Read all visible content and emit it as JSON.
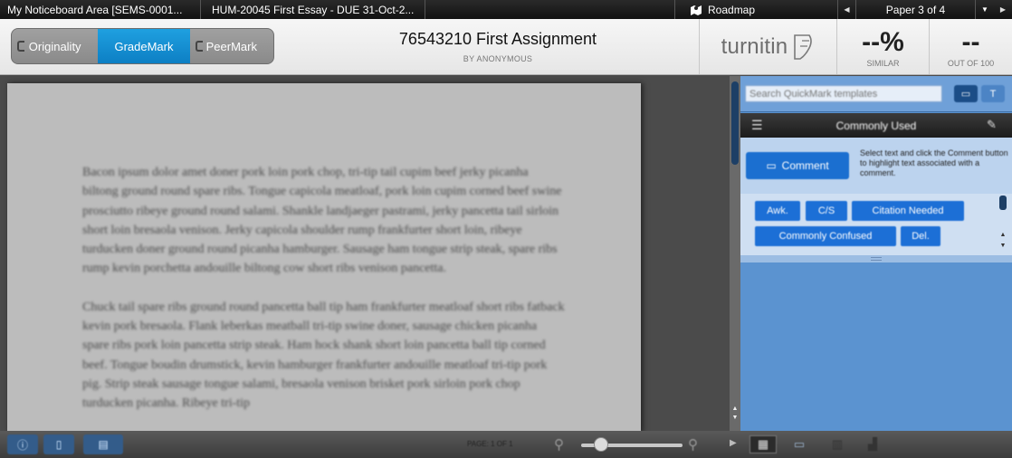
{
  "topbar": {
    "class_name": "My Noticeboard Area [SEMS-0001...",
    "assignment": "HUM-20045 First Essay - DUE 31-Oct-2...",
    "roadmap": "Roadmap",
    "prev_icon": "triangle-left-icon",
    "paper_counter": "Paper 3 of 4",
    "dropdown_icon": "triangle-down-icon",
    "next_icon": "triangle-right-icon"
  },
  "header": {
    "modes": [
      "Originality",
      "GradeMark",
      "PeerMark"
    ],
    "active_mode": "GradeMark",
    "document_title": "76543210 First Assignment",
    "author": "BY ANONYMOUS",
    "logo_text": "turnitin",
    "similarity_value": "--%",
    "similarity_label": "SIMILAR",
    "grade_value": "--",
    "grade_label": "OUT OF 100"
  },
  "document": {
    "paragraphs": [
      "Bacon ipsum dolor amet doner pork loin pork chop, tri-tip tail cupim beef jerky picanha biltong ground round spare ribs. Tongue capicola meatloaf, pork loin cupim corned beef swine prosciutto ribeye ground round salami. Shankle landjaeger pastrami, jerky pancetta tail sirloin short loin bresaola venison. Jerky capicola shoulder rump frankfurter short loin, ribeye turducken doner ground round picanha hamburger. Sausage ham tongue strip steak, spare ribs rump kevin porchetta andouille biltong cow short ribs venison pancetta.",
      "Chuck tail spare ribs ground round pancetta ball tip ham frankfurter meatloaf short ribs fatback kevin pork bresaola. Flank leberkas meatball tri-tip swine doner, sausage chicken picanha spare ribs pork loin pancetta strip steak. Ham hock shank short loin pancetta ball tip corned beef. Tongue boudin drumstick, kevin hamburger frankfurter andouille meatloaf tri-tip pork pig. Strip steak sausage tongue salami, bresaola venison brisket pork sirloin pork chop turducken picanha. Ribeye tri-tip"
    ]
  },
  "footer": {
    "page_indicator": "PAGE: 1 OF 1",
    "zoom_out_icon": "zoom-out-icon",
    "zoom_in_icon": "zoom-in-icon",
    "zoom_level_fraction": 0.2
  },
  "quickmark": {
    "search_placeholder": "Search QuickMark templates",
    "set_title": "Commonly Used",
    "comment_button": "Comment",
    "comment_help": "Select text and click the Comment button to highlight text associated with a comment.",
    "marks": [
      "Awk.",
      "C/S",
      "Citation Needed",
      "Commonly Confused",
      "Del."
    ]
  },
  "colors": {
    "accent": "#0d7fc4",
    "panel": "#5b93d0",
    "chip": "#1c6fd6"
  }
}
